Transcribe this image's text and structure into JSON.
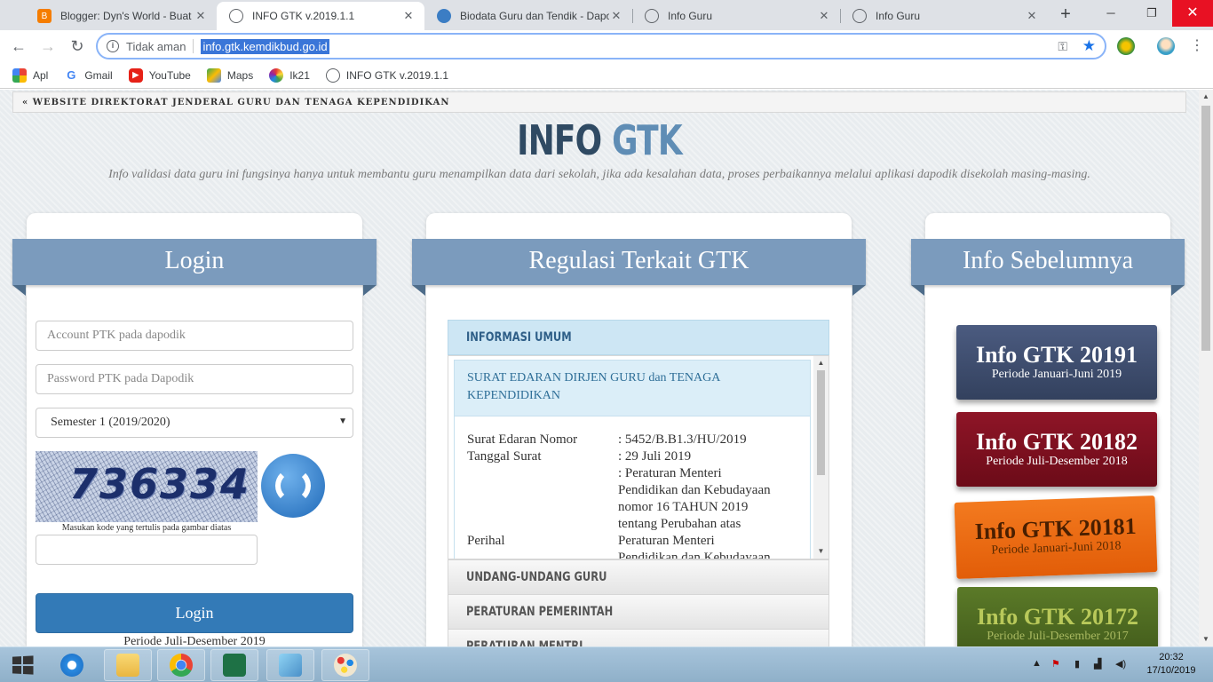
{
  "browser": {
    "tabs": [
      {
        "title": "Blogger: Dyn's World - Buat entri",
        "icon": "blogger-icon",
        "color": "#f57d00"
      },
      {
        "title": "INFO GTK v.2019.1.1",
        "icon": "globe-icon",
        "color": "#5f6368"
      },
      {
        "title": "Biodata Guru dan Tendik - Dapo",
        "icon": "kemdikbud-icon",
        "color": "#3b7dc4"
      },
      {
        "title": "Info Guru",
        "icon": "globe-icon",
        "color": "#5f6368"
      },
      {
        "title": "Info Guru",
        "icon": "globe-icon",
        "color": "#5f6368"
      }
    ],
    "active_tab_index": 1,
    "new_tab_label": "+",
    "security_label": "Tidak aman",
    "url": "info.gtk.kemdikbud.go.id",
    "bookmarks": [
      {
        "label": "Apl",
        "icon": "apps-grid-icon"
      },
      {
        "label": "Gmail",
        "icon": "google-icon"
      },
      {
        "label": "YouTube",
        "icon": "youtube-icon"
      },
      {
        "label": "Maps",
        "icon": "maps-icon"
      },
      {
        "label": "Ik21",
        "icon": "ik21-icon"
      },
      {
        "label": "INFO GTK v.2019.1.1",
        "icon": "globe-icon"
      }
    ]
  },
  "page": {
    "top_link": "« WEBSITE DIREKTORAT JENDERAL GURU DAN TENAGA KEPENDIDIKAN",
    "brand_part1": "INFO",
    "brand_part2": "GTK",
    "tagline": "Info validasi data guru ini fungsinya hanya untuk membantu guru menampilkan data dari sekolah, jika ada kesalahan data, proses perbaikannya melalui aplikasi dapodik disekolah masing-masing.",
    "login": {
      "heading": "Login",
      "account_placeholder": "Account PTK pada dapodik",
      "password_placeholder": "Password PTK pada Dapodik",
      "semester_selected": "Semester 1 (2019/2020)",
      "captcha_code": "736334",
      "captcha_hint": "Masukan kode yang tertulis pada gambar diatas",
      "button": "Login",
      "periode": "Periode Juli-Desember 2019"
    },
    "regulasi": {
      "heading": "Regulasi Terkait GTK",
      "sections": [
        "INFORMASI UMUM",
        "UNDANG-UNDANG GURU",
        "PERATURAN PEMERINTAH",
        "PERATURAN MENTRI"
      ],
      "item_title": "SURAT EDARAN DIRJEN GURU dan TENAGA KEPENDIDIKAN",
      "fields": {
        "nomor_label": "Surat Edaran Nomor",
        "nomor_value": ": 5452/B.B1.3/HU/2019",
        "tanggal_label": "Tanggal Surat",
        "tanggal_value": ": 29 Juli 2019",
        "perihal_label": "Perihal",
        "perihal_lines": [
          ": Peraturan Menteri",
          "Pendidikan dan Kebudayaan",
          "nomor 16 TAHUN 2019",
          "tentang Perubahan atas",
          "Peraturan Menteri",
          "Pendidikan dan Kebudayaan"
        ]
      }
    },
    "info_sebelumnya": {
      "heading": "Info Sebelumnya",
      "cards": [
        {
          "title": "Info GTK 20191",
          "period": "Periode Januari-Juni 2019",
          "color": "#3d4c6e"
        },
        {
          "title": "Info GTK 20182",
          "period": "Periode Juli-Desember 2018",
          "color": "#7e0f1e"
        },
        {
          "title": "Info GTK 20181",
          "period": "Periode Januari-Juni 2018",
          "color": "#f06a10"
        },
        {
          "title": "Info GTK 20172",
          "period": "Periode Juli-Desember 2017",
          "color": "#4e6b22"
        }
      ]
    }
  },
  "taskbar": {
    "time": "20:32",
    "date": "17/10/2019"
  }
}
